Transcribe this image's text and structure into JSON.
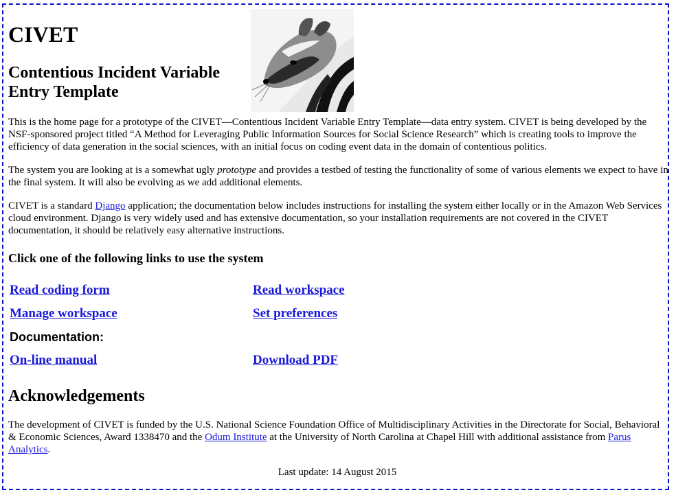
{
  "header": {
    "title": "CIVET",
    "subtitle": "Contentious Incident Variable Entry Template"
  },
  "image": {
    "icon": "civet-photo"
  },
  "intro": {
    "p1": "This is the home page for a prototype of the CIVET—Contentious Incident Variable Entry Template—data entry system. CIVET is being developed by the NSF-sponsored project titled “A Method for Leveraging Public Information Sources for Social Science Research” which is creating tools to improve the efficiency of data generation in the social sciences, with an initial focus on coding event data in the domain of contentious politics.",
    "p2_before": "The system you are looking at is a somewhat ugly ",
    "p2_em": "prototype",
    "p2_after": " and provides a testbed of testing the functionality of some of various elements we expect to have in the final system. It will also be evolving as we add additional elements.",
    "p3_before": "CIVET is a standard ",
    "p3_link": "Django",
    "p3_after": " application; the documentation below includes instructions for installing the system either locally or in the Amazon Web Services cloud environment. Django is very widely used and has extensive documentation, so your installation requirements are not covered in the CIVET documentation, it should be relatively easy alternative instructions."
  },
  "links": {
    "heading": "Click one of the following links to use the system",
    "read_coding_form": "Read coding form",
    "read_workspace": "Read workspace",
    "manage_workspace": "Manage workspace",
    "set_preferences": "Set preferences",
    "documentation_label": "Documentation:",
    "online_manual": "On-line manual",
    "download_pdf": "Download PDF"
  },
  "acknowledgements": {
    "heading": "Acknowledgements",
    "text_before": "The development of CIVET is funded by the U.S. National Science Foundation Office of Multidisciplinary Activities in the Directorate for Social, Behavioral & Economic Sciences, Award 1338470 and the ",
    "link1": "Odum Institute",
    "text_middle": " at the University of North Carolina at Chapel Hill with additional assistance from ",
    "link2": "Parus Analytics",
    "text_after": "."
  },
  "footer": {
    "last_update": "Last update: 14 August 2015"
  }
}
